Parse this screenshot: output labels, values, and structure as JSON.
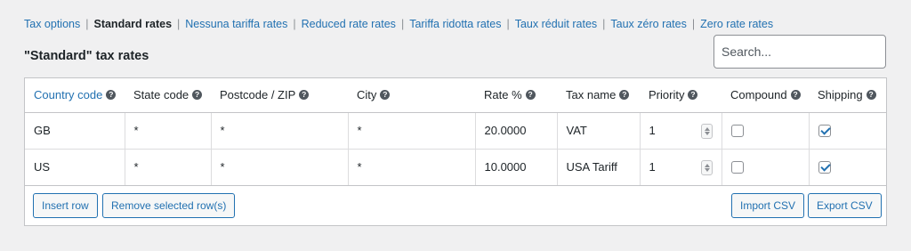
{
  "tabs": {
    "tax_options": "Tax options",
    "standard_rates": "Standard rates",
    "nessuna": "Nessuna tariffa rates",
    "reduced": "Reduced rate rates",
    "ridotta": "Tariffa ridotta rates",
    "reduit": "Taux réduit rates",
    "zero_fr": "Taux zéro rates",
    "zero": "Zero rate rates"
  },
  "page_title": "\"Standard\" tax rates",
  "search": {
    "placeholder": "Search..."
  },
  "columns": {
    "country": "Country code",
    "state": "State code",
    "postcode": "Postcode / ZIP",
    "city": "City",
    "rate": "Rate %",
    "name": "Tax name",
    "priority": "Priority",
    "compound": "Compound",
    "shipping": "Shipping"
  },
  "rows": [
    {
      "country": "GB",
      "state": "*",
      "postcode": "*",
      "city": "*",
      "rate": "20.0000",
      "name": "VAT",
      "priority": "1",
      "compound": false,
      "shipping": true
    },
    {
      "country": "US",
      "state": "*",
      "postcode": "*",
      "city": "*",
      "rate": "10.0000",
      "name": "USA Tariff",
      "priority": "1",
      "compound": false,
      "shipping": true
    }
  ],
  "buttons": {
    "insert": "Insert row",
    "remove": "Remove selected row(s)",
    "import": "Import CSV",
    "export": "Export CSV"
  },
  "help_glyph": "?",
  "colors": {
    "link": "#2271b1",
    "background": "#f0f0f1",
    "border": "#c3c4c7"
  }
}
